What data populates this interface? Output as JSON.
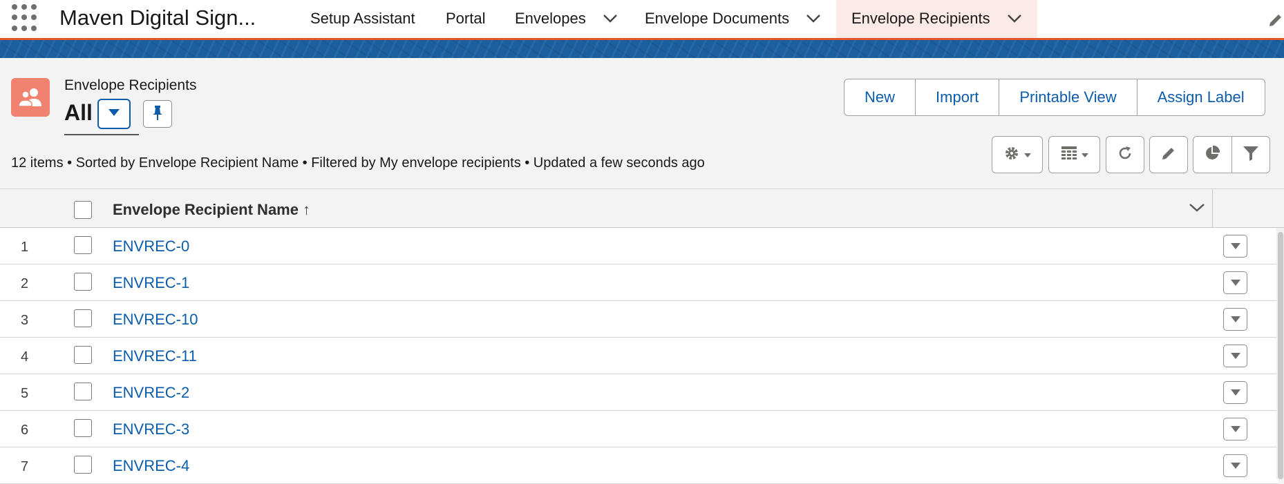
{
  "nav": {
    "app_launcher_icon": "waffle-grid-icon",
    "app_name": "Maven Digital Sign...",
    "tabs": [
      {
        "label": "Setup Assistant",
        "has_menu": false,
        "active": false
      },
      {
        "label": "Portal",
        "has_menu": false,
        "active": false
      },
      {
        "label": "Envelopes",
        "has_menu": true,
        "active": false
      },
      {
        "label": "Envelope Documents",
        "has_menu": true,
        "active": false
      },
      {
        "label": "Envelope Recipients",
        "has_menu": true,
        "active": true
      }
    ],
    "edit_icon": "pencil-icon"
  },
  "header": {
    "object_icon": "people-icon",
    "object_label": "Envelope Recipients",
    "list_view_name": "All",
    "actions": [
      "New",
      "Import",
      "Printable View",
      "Assign Label"
    ],
    "status": "12 items • Sorted by Envelope Recipient Name • Filtered by My envelope recipients • Updated a few seconds ago",
    "tools": [
      "gear-icon",
      "table-icon",
      "refresh-icon",
      "pencil-icon",
      "pie-chart-icon",
      "filter-icon"
    ]
  },
  "table": {
    "column_header": "Envelope Recipient Name",
    "sort_arrow": "↑",
    "rows": [
      {
        "num": "1",
        "name": "ENVREC-0"
      },
      {
        "num": "2",
        "name": "ENVREC-1"
      },
      {
        "num": "3",
        "name": "ENVREC-10"
      },
      {
        "num": "4",
        "name": "ENVREC-11"
      },
      {
        "num": "5",
        "name": "ENVREC-2"
      },
      {
        "num": "6",
        "name": "ENVREC-3"
      },
      {
        "num": "7",
        "name": "ENVREC-4"
      }
    ]
  },
  "colors": {
    "accent_blue": "#0b5cab",
    "nav_underline": "#e2562b",
    "banner": "#1b5f9e",
    "object_icon_bg": "#f0826f",
    "active_tab_bg": "#fbeae6"
  }
}
